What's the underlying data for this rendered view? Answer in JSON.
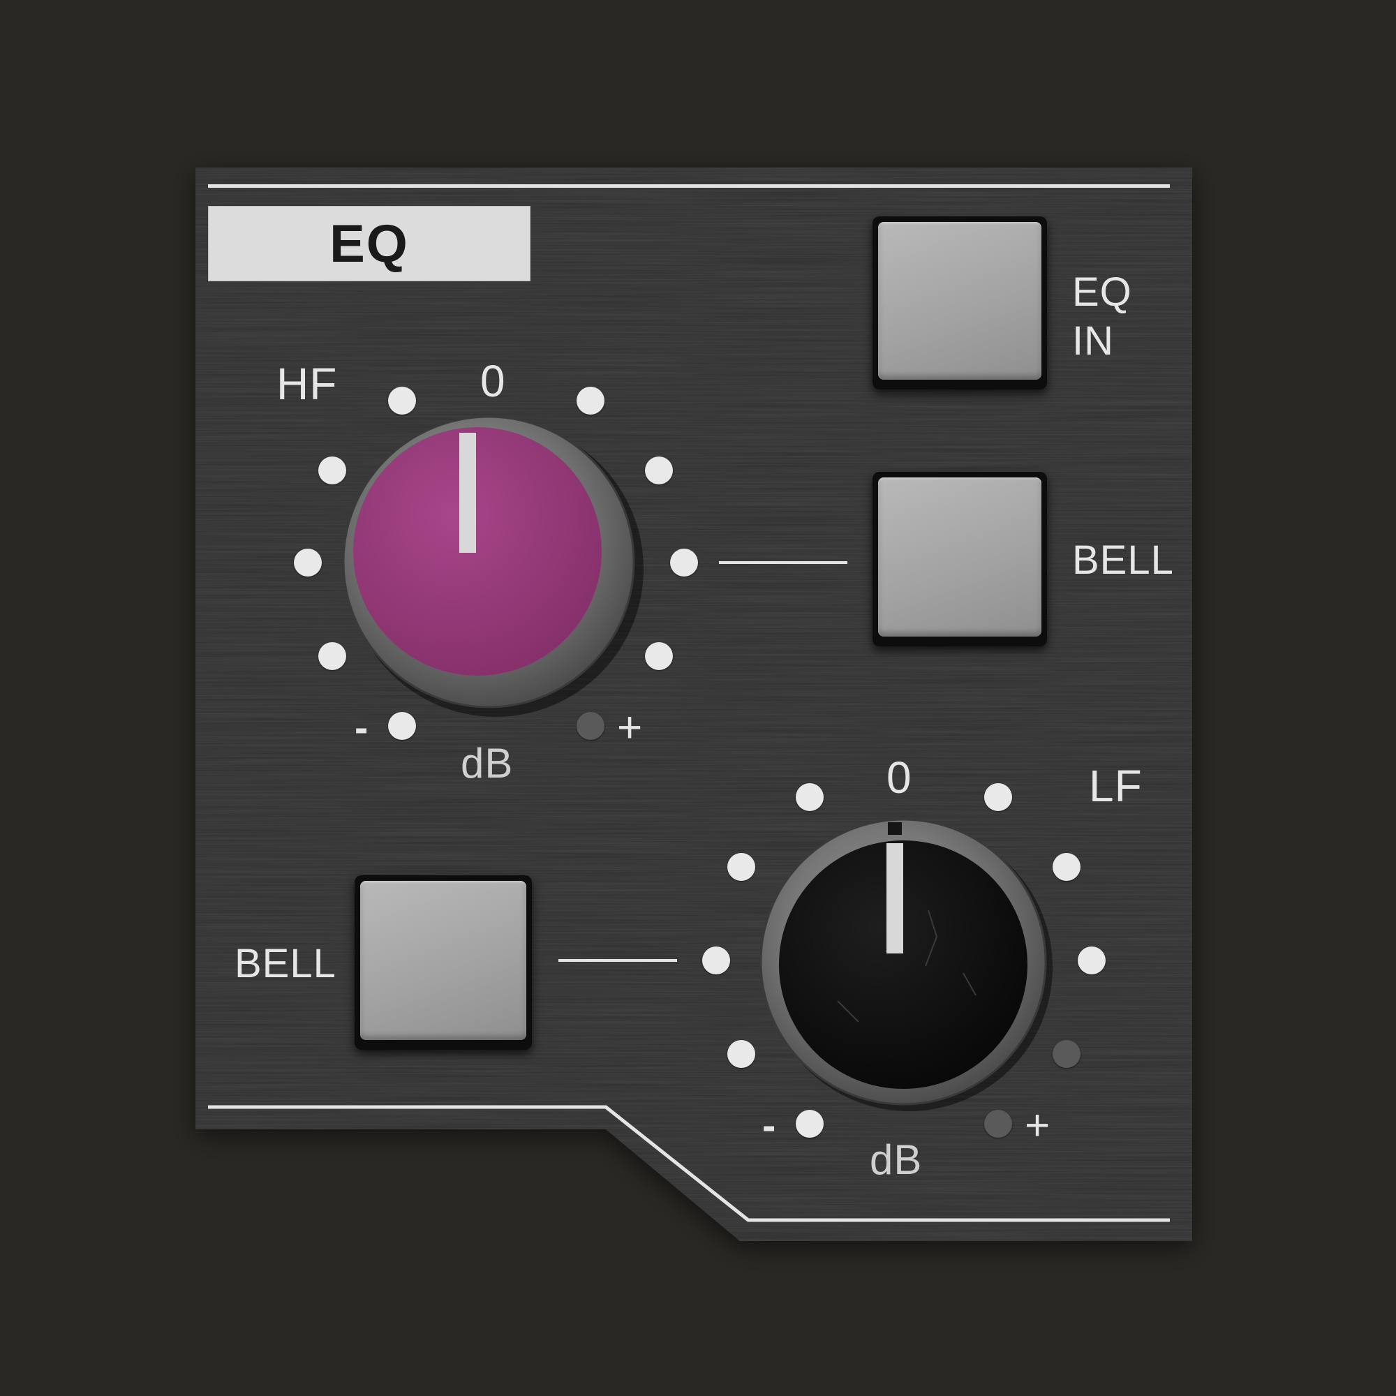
{
  "module": {
    "title": "EQ"
  },
  "hf": {
    "band_label": "HF",
    "zero_label": "0",
    "unit_label": "dB",
    "minus_label": "-",
    "plus_label": "+",
    "knob_color": "#9a3a78",
    "gain_position": "center"
  },
  "lf": {
    "band_label": "LF",
    "zero_label": "0",
    "unit_label": "dB",
    "minus_label": "-",
    "plus_label": "+",
    "knob_color": "#121212",
    "gain_position": "center"
  },
  "buttons": {
    "eq_in_line1": "EQ",
    "eq_in_line2": "IN",
    "hf_bell": "BELL",
    "lf_bell": "BELL"
  },
  "colors": {
    "background": "#2a2824",
    "panel": "#2f2f2f",
    "legend_text": "#e6e6e6",
    "button_cap": "#a8a8a8"
  }
}
